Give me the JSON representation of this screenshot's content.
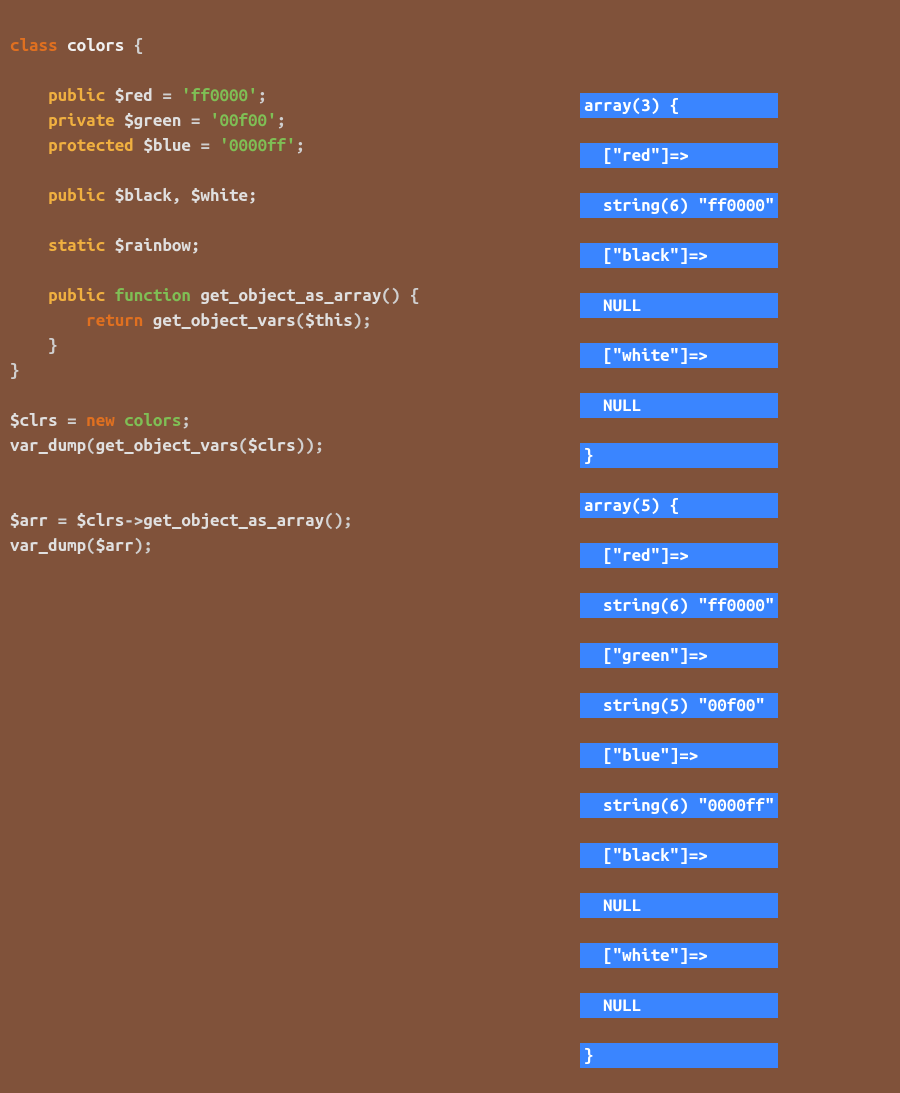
{
  "code": {
    "l1_class": "class",
    "l1_name": "colors",
    "l1_brace": " {",
    "l3_access": "public",
    "l3_var": "$red",
    "l3_assign": " = ",
    "l3_str": "'ff0000'",
    "l3_semi": ";",
    "l4_access": "private",
    "l4_var": "$green",
    "l4_assign": " = ",
    "l4_str": "'00f00'",
    "l4_semi": ";",
    "l5_access": "protected",
    "l5_var": "$blue",
    "l5_assign": " = ",
    "l5_str": "'0000ff'",
    "l5_semi": ";",
    "l7_access": "public",
    "l7_vars": "$black, $white;",
    "l9_static": "static",
    "l9_var": "$rainbow;",
    "l11_access": "public",
    "l11_func": "function",
    "l11_fname": "get_object_as_array",
    "l11_parens": "() {",
    "l12_return": "return",
    "l12_call": "get_object_vars",
    "l12_open": "(",
    "l12_this": "$this",
    "l12_close": ");",
    "l13_brace": "}",
    "l14_brace": "}",
    "l16_var": "$clrs",
    "l16_assign": " = ",
    "l16_new": "new",
    "l16_type": "colors",
    "l16_semi": ";",
    "l17_call": "var_dump",
    "l17_open": "(",
    "l17_inner": "get_object_vars",
    "l17_open2": "(",
    "l17_arg": "$clrs",
    "l17_close": "));",
    "l20_var": "$arr",
    "l20_assign": " = ",
    "l20_obj": "$clrs",
    "l20_arrow": "->",
    "l20_method": "get_object_as_array",
    "l20_parens": "();",
    "l21_call": "var_dump",
    "l21_open": "(",
    "l21_arg": "$arr",
    "l21_close": ");"
  },
  "output": {
    "o1": "array(3) {",
    "o2": "[\"red\"]=>",
    "o3": "string(6) \"ff0000\"",
    "o4": "[\"black\"]=>",
    "o5": "NULL",
    "o6": "[\"white\"]=>",
    "o7": "NULL",
    "o8": "}",
    "o9": "array(5) {",
    "o10": "[\"red\"]=>",
    "o11": "string(6) \"ff0000\"",
    "o12": "[\"green\"]=>",
    "o13": "string(5) \"00f00\"",
    "o14": "[\"blue\"]=>",
    "o15": "string(6) \"0000ff\"",
    "o16": "[\"black\"]=>",
    "o17": "NULL",
    "o18": "[\"white\"]=>",
    "o19": "NULL",
    "o20": "}"
  }
}
